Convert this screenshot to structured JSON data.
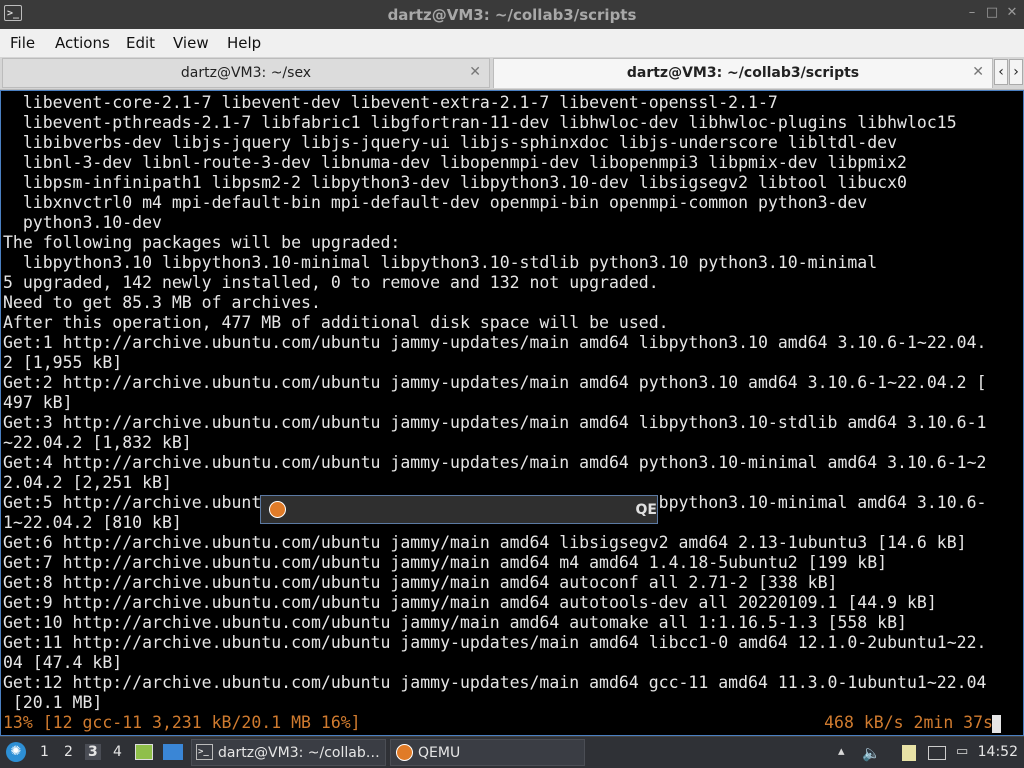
{
  "window": {
    "title": "dartz@VM3: ~/collab3/scripts",
    "app_icon_glyph": ">_",
    "buttons": [
      "–",
      "□",
      "✕"
    ]
  },
  "menu": [
    "File",
    "Actions",
    "Edit",
    "View",
    "Help"
  ],
  "tabs": [
    {
      "label": "dartz@VM3: ~/sex",
      "active": false
    },
    {
      "label": "dartz@VM3: ~/collab3/scripts",
      "active": true
    }
  ],
  "tab_nav": {
    "prev": "‹",
    "next": "›"
  },
  "terminal": {
    "lines": [
      "  libevent-core-2.1-7 libevent-dev libevent-extra-2.1-7 libevent-openssl-2.1-7",
      "  libevent-pthreads-2.1-7 libfabric1 libgfortran-11-dev libhwloc-dev libhwloc-plugins libhwloc15",
      "  libibverbs-dev libjs-jquery libjs-jquery-ui libjs-sphinxdoc libjs-underscore libltdl-dev",
      "  libnl-3-dev libnl-route-3-dev libnuma-dev libopenmpi-dev libopenmpi3 libpmix-dev libpmix2",
      "  libpsm-infinipath1 libpsm2-2 libpython3-dev libpython3.10-dev libsigsegv2 libtool libucx0",
      "  libxnvctrl0 m4 mpi-default-bin mpi-default-dev openmpi-bin openmpi-common python3-dev",
      "  python3.10-dev",
      "The following packages will be upgraded:",
      "  libpython3.10 libpython3.10-minimal libpython3.10-stdlib python3.10 python3.10-minimal",
      "5 upgraded, 142 newly installed, 0 to remove and 132 not upgraded.",
      "Need to get 85.3 MB of archives.",
      "After this operation, 477 MB of additional disk space will be used.",
      "Get:1 http://archive.ubuntu.com/ubuntu jammy-updates/main amd64 libpython3.10 amd64 3.10.6-1~22.04.",
      "2 [1,955 kB]",
      "Get:2 http://archive.ubuntu.com/ubuntu jammy-updates/main amd64 python3.10 amd64 3.10.6-1~22.04.2 [",
      "497 kB]",
      "Get:3 http://archive.ubuntu.com/ubuntu jammy-updates/main amd64 libpython3.10-stdlib amd64 3.10.6-1",
      "~22.04.2 [1,832 kB]",
      "Get:4 http://archive.ubuntu.com/ubuntu jammy-updates/main amd64 python3.10-minimal amd64 3.10.6-1~2",
      "2.04.2 [2,251 kB]",
      "Get:5 http://archive.ubuntu.com/ubuntu jammy-updates/main amd64 libpython3.10-minimal amd64 3.10.6-",
      "1~22.04.2 [810 kB]",
      "Get:6 http://archive.ubuntu.com/ubuntu jammy/main amd64 libsigsegv2 amd64 2.13-1ubuntu3 [14.6 kB]",
      "Get:7 http://archive.ubuntu.com/ubuntu jammy/main amd64 m4 amd64 1.4.18-5ubuntu2 [199 kB]",
      "Get:8 http://archive.ubuntu.com/ubuntu jammy/main amd64 autoconf all 2.71-2 [338 kB]",
      "Get:9 http://archive.ubuntu.com/ubuntu jammy/main amd64 autotools-dev all 20220109.1 [44.9 kB]",
      "Get:10 http://archive.ubuntu.com/ubuntu jammy/main amd64 automake all 1:1.16.5-1.3 [558 kB]",
      "Get:11 http://archive.ubuntu.com/ubuntu jammy-updates/main amd64 libcc1-0 amd64 12.1.0-2ubuntu1~22.",
      "04 [47.4 kB]",
      "Get:12 http://archive.ubuntu.com/ubuntu jammy-updates/main amd64 gcc-11 amd64 11.3.0-1ubuntu1~22.04",
      " [20.1 MB]"
    ],
    "status_left": "13% [12 gcc-11 3,231 kB/20.1 MB 16%]",
    "status_right": "468 kB/s 2min 37s"
  },
  "qemu_popup": {
    "label": "QE"
  },
  "taskbar": {
    "workspaces": [
      "1",
      "2",
      "3",
      "4"
    ],
    "active_workspace": "3",
    "tasks": [
      {
        "label": "dartz@VM3: ~/collab…"
      },
      {
        "label": "QEMU"
      }
    ],
    "clock": "14:52"
  },
  "colors": {
    "terminal_bg": "#000000",
    "terminal_fg": "#e6e6e6",
    "status_fg": "#d07b2f",
    "accent": "#4a7fc1"
  }
}
